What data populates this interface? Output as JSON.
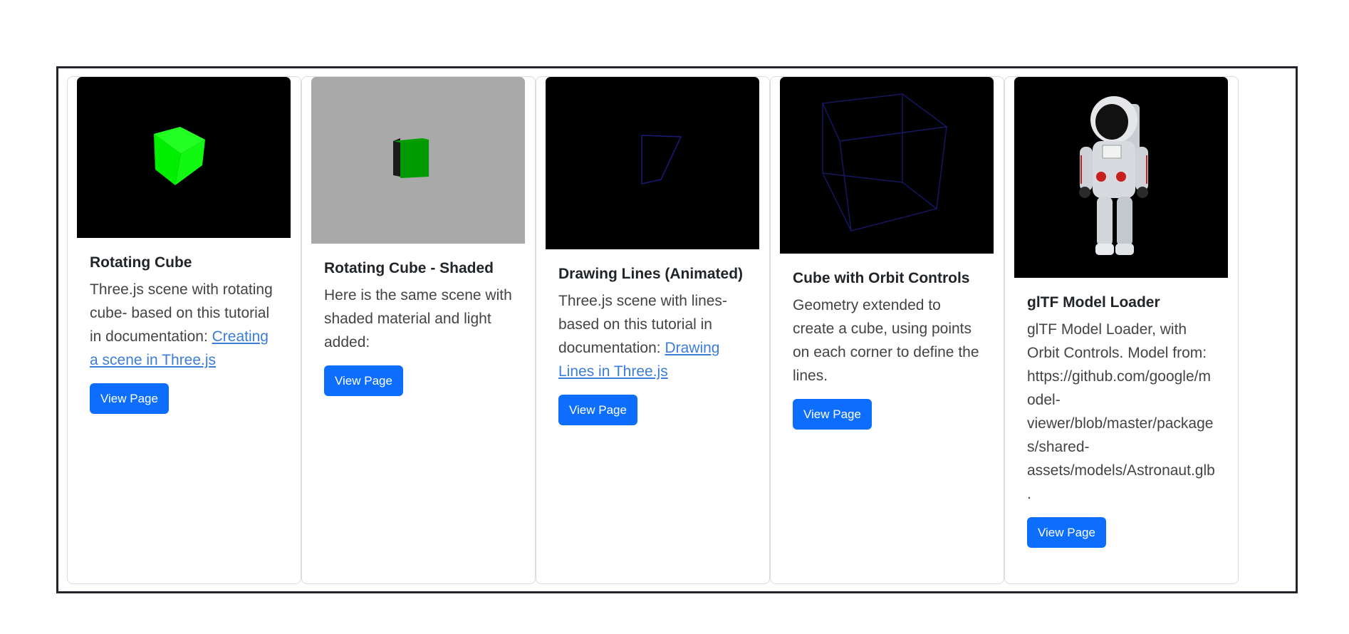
{
  "cards": [
    {
      "title": "Rotating Cube",
      "text": "Three.js scene with rotating cube- based on this tutorial in documentation: ",
      "link": "Creating a scene in Three.js",
      "button": "View Page"
    },
    {
      "title": "Rotating Cube - Shaded",
      "text": "Here is the same scene with shaded material and light added:",
      "link": "",
      "button": "View Page"
    },
    {
      "title": "Drawing Lines (Animated)",
      "text": "Three.js scene with lines- based on this tutorial in documentation: ",
      "link": "Drawing Lines in Three.js",
      "button": "View Page"
    },
    {
      "title": "Cube with Orbit Controls",
      "text": "Geometry extended to create a cube, using points on each corner to define the lines.",
      "link": "",
      "button": "View Page"
    },
    {
      "title": "glTF Model Loader",
      "text": "glTF Model Loader, with Orbit Controls. Model from: https://github.com/google/model-viewer/blob/master/packages/shared-assets/models/Astronaut.glb.",
      "link": "",
      "button": "View Page"
    }
  ],
  "colors": {
    "button": "#0d6efd",
    "link": "#3b7dd8",
    "scene_black": "#000000",
    "scene_gray": "#a9a9a9",
    "cube_green": "#00ff00"
  }
}
